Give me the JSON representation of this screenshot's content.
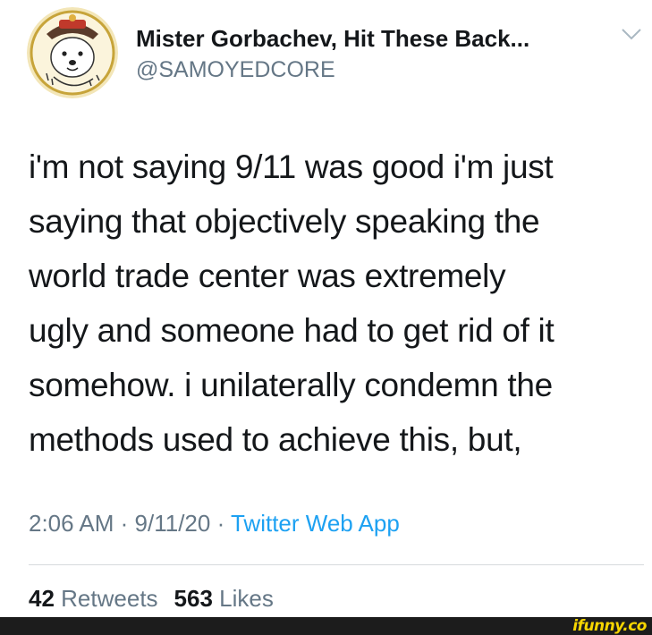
{
  "author": {
    "display_name": "Mister Gorbachev, Hit These Back...",
    "handle": "@SAMOYEDCORE",
    "avatar_icon": "samoyed-dog-avatar-icon"
  },
  "menu": {
    "icon": "chevron-down-icon"
  },
  "tweet": {
    "text": "i'm not saying 9/11 was good i'm just\nsaying that objectively speaking the\nworld trade center was extremely\nugly and someone had to get rid of it\nsomehow. i unilaterally condemn the\nmethods used to achieve this, but,"
  },
  "meta": {
    "time": "2:06 AM",
    "sep1": " · ",
    "date": "9/11/20",
    "sep2": " · ",
    "source": "Twitter Web App"
  },
  "stats": {
    "retweets_count": "42",
    "retweets_label": "Retweets",
    "likes_count": "563",
    "likes_label": "Likes"
  },
  "watermark": {
    "text": "ifunny.co"
  },
  "colors": {
    "text": "#14171a",
    "muted": "#657786",
    "link": "#1da1f2",
    "divider": "#d6dadd",
    "watermark_bar": "#1c1c1c",
    "watermark_text": "#f7d600"
  }
}
